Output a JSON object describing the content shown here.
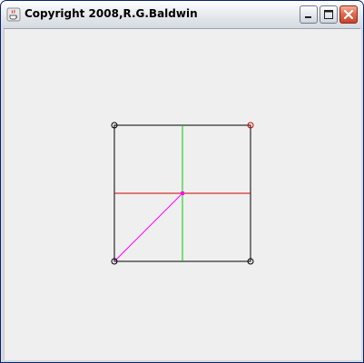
{
  "window": {
    "title": "Copyright  2008,R.G.Baldwin",
    "title_icon": "java-cup-icon",
    "buttons": {
      "minimize": "minimize-icon",
      "maximize": "maximize-icon",
      "close": "close-icon"
    }
  },
  "colors": {
    "square_outline": "#000000",
    "horizontal_line": "#cc0000",
    "vertical_line": "#00cc00",
    "diagonal_line": "#ff00ff",
    "center_marker": "#ff00ff",
    "corner_marker_default": "#000000",
    "corner_marker_highlight": "#cc0000",
    "client_background": "#efefef"
  }
}
